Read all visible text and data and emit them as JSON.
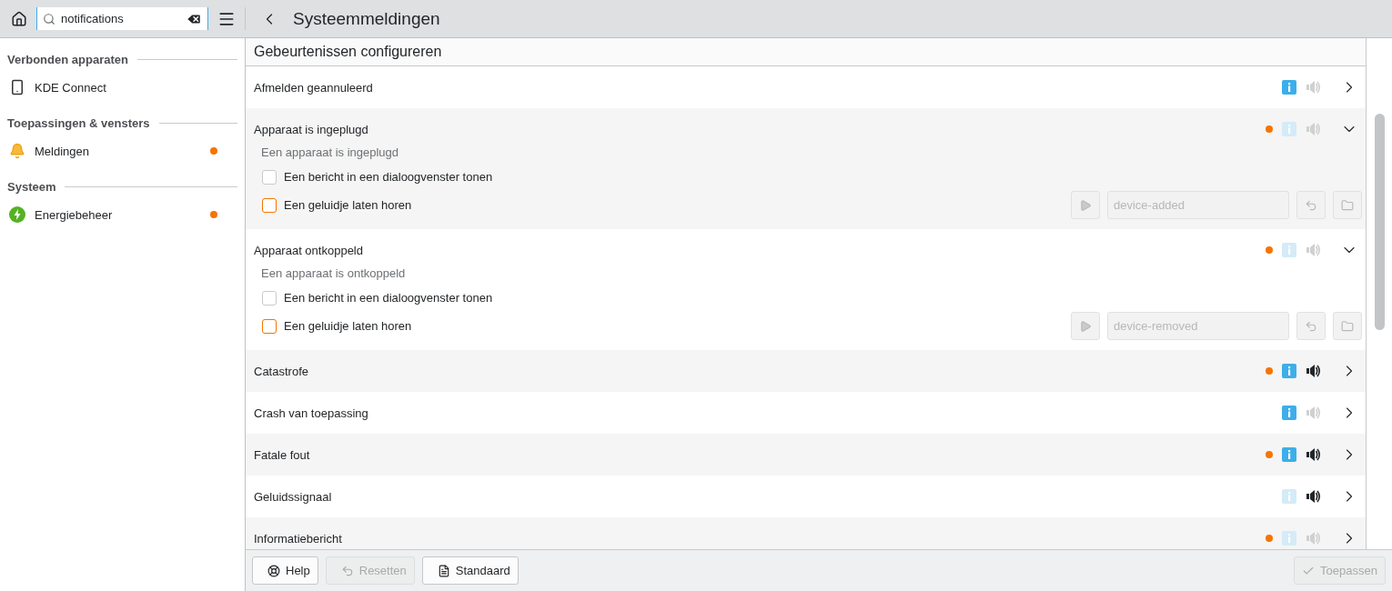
{
  "search": {
    "value": "notifications"
  },
  "page_title": "Systeemmeldingen",
  "sidebar": {
    "sections": [
      {
        "title": "Verbonden apparaten",
        "items": [
          {
            "label": "KDE Connect",
            "kind": "phone",
            "modified": false
          }
        ]
      },
      {
        "title": "Toepassingen & vensters",
        "items": [
          {
            "label": "Meldingen",
            "kind": "bell",
            "modified": true
          }
        ]
      },
      {
        "title": "Systeem",
        "items": [
          {
            "label": "Energiebeheer",
            "kind": "power",
            "modified": true
          }
        ]
      }
    ]
  },
  "section_title": "Gebeurtenissen configureren",
  "events": [
    {
      "name": "Afmelden geannuleerd",
      "modified": false,
      "popup": true,
      "sound": false,
      "expanded": false
    },
    {
      "name": "Apparaat is ingeplugd",
      "modified": true,
      "popup": false,
      "sound": false,
      "expanded": true,
      "description": "Een apparaat is ingeplugd",
      "options": [
        {
          "kind": "popup",
          "label": "Een bericht in een dialoogvenster tonen",
          "checked": false,
          "color": "#c8cacc"
        },
        {
          "kind": "sound",
          "label": "Een geluidje laten horen",
          "checked": false,
          "color": "#f67400",
          "file": "device-added"
        }
      ]
    },
    {
      "name": "Apparaat ontkoppeld",
      "modified": true,
      "popup": false,
      "sound": false,
      "expanded": true,
      "description": "Een apparaat is ontkoppeld",
      "options": [
        {
          "kind": "popup",
          "label": "Een bericht in een dialoogvenster tonen",
          "checked": false,
          "color": "#c8cacc"
        },
        {
          "kind": "sound",
          "label": "Een geluidje laten horen",
          "checked": false,
          "color": "#f67400",
          "file": "device-removed"
        }
      ]
    },
    {
      "name": "Catastrofe",
      "modified": true,
      "popup": true,
      "sound": true,
      "expanded": false
    },
    {
      "name": "Crash van toepassing",
      "modified": false,
      "popup": true,
      "sound": false,
      "expanded": false
    },
    {
      "name": "Fatale fout",
      "modified": true,
      "popup": true,
      "sound": true,
      "expanded": false
    },
    {
      "name": "Geluidssignaal",
      "modified": false,
      "popup": false,
      "sound": true,
      "expanded": false
    },
    {
      "name": "Informatiebericht",
      "modified": true,
      "popup": false,
      "sound": false,
      "expanded": false
    }
  ],
  "footer": {
    "buttons": [
      {
        "kind": "help",
        "label": "Help",
        "disabled": false
      },
      {
        "kind": "reset",
        "label": "Resetten",
        "disabled": true
      },
      {
        "kind": "defaults",
        "label": "Standaard",
        "disabled": false
      }
    ],
    "apply": {
      "label": "Toepassen",
      "disabled": true
    }
  }
}
